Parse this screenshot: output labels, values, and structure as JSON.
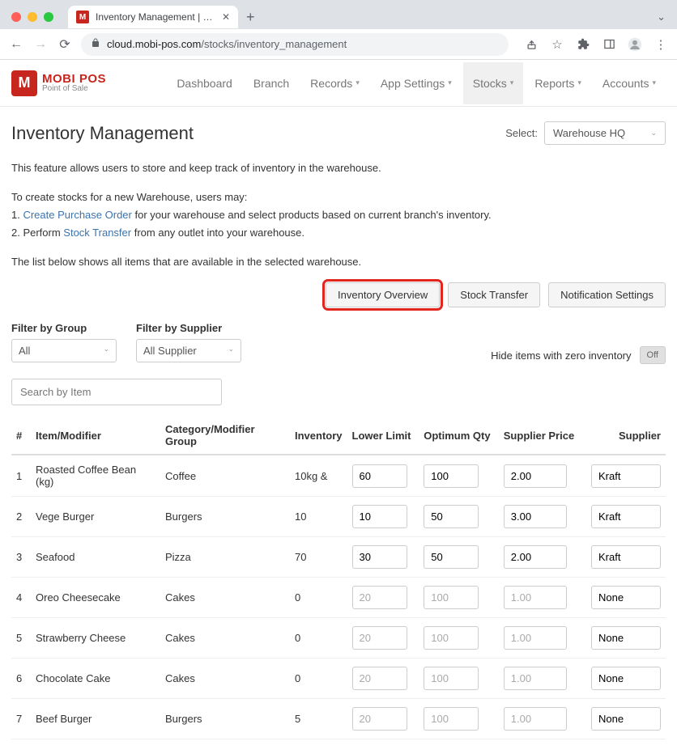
{
  "browser": {
    "tab_title": "Inventory Management | MobiP",
    "url_host": "cloud.mobi-pos.com",
    "url_path": "/stocks/inventory_management"
  },
  "logo": {
    "brand": "MOBI POS",
    "sub": "Point of Sale"
  },
  "nav": {
    "items": [
      {
        "label": "Dashboard",
        "dropdown": false
      },
      {
        "label": "Branch",
        "dropdown": false
      },
      {
        "label": "Records",
        "dropdown": true
      },
      {
        "label": "App Settings",
        "dropdown": true
      },
      {
        "label": "Stocks",
        "dropdown": true,
        "active": true
      },
      {
        "label": "Reports",
        "dropdown": true
      },
      {
        "label": "Accounts",
        "dropdown": true
      }
    ]
  },
  "page": {
    "title": "Inventory Management",
    "select_label": "Select:",
    "select_value": "Warehouse HQ",
    "intro_line": "This feature allows users to store and keep track of inventory in the warehouse.",
    "instr_head": "To create stocks for a new Warehouse, users may:",
    "instr_1_pre": "1. ",
    "instr_1_link": "Create Purchase Order",
    "instr_1_post": " for your warehouse and select products based on current branch's inventory.",
    "instr_2_pre": "2. Perform ",
    "instr_2_link": "Stock Transfer",
    "instr_2_post": " from any outlet into your warehouse.",
    "list_intro": "The list below shows all items that are available in the selected warehouse.",
    "btn_overview": "Inventory Overview",
    "btn_transfer": "Stock Transfer",
    "btn_notif": "Notification Settings",
    "filter_group_label": "Filter by Group",
    "filter_group_value": "All",
    "filter_supplier_label": "Filter by Supplier",
    "filter_supplier_value": "All Supplier",
    "hide_zero_label": "Hide items with zero inventory",
    "hide_zero_toggle": "Off",
    "search_placeholder": "Search by Item"
  },
  "table": {
    "headers": {
      "num": "#",
      "item": "Item/Modifier",
      "category": "Category/Modifier Group",
      "inventory": "Inventory",
      "lower": "Lower Limit",
      "optimum": "Optimum Qty",
      "price": "Supplier Price",
      "supplier": "Supplier"
    },
    "rows": [
      {
        "n": "1",
        "item": "Roasted Coffee Bean (kg)",
        "cat": "Coffee",
        "inv": "10kg &",
        "lower": "60",
        "opt": "100",
        "price": "2.00",
        "sup": "Kraft",
        "disabled": false
      },
      {
        "n": "2",
        "item": "Vege Burger",
        "cat": "Burgers",
        "inv": "10",
        "lower": "10",
        "opt": "50",
        "price": "3.00",
        "sup": "Kraft",
        "disabled": false
      },
      {
        "n": "3",
        "item": "Seafood",
        "cat": "Pizza",
        "inv": "70",
        "lower": "30",
        "opt": "50",
        "price": "2.00",
        "sup": "Kraft",
        "disabled": false
      },
      {
        "n": "4",
        "item": "Oreo Cheesecake",
        "cat": "Cakes",
        "inv": "0",
        "lower": "20",
        "opt": "100",
        "price": "1.00",
        "sup": "None",
        "disabled": true
      },
      {
        "n": "5",
        "item": "Strawberry Cheese",
        "cat": "Cakes",
        "inv": "0",
        "lower": "20",
        "opt": "100",
        "price": "1.00",
        "sup": "None",
        "disabled": true
      },
      {
        "n": "6",
        "item": "Chocolate Cake",
        "cat": "Cakes",
        "inv": "0",
        "lower": "20",
        "opt": "100",
        "price": "1.00",
        "sup": "None",
        "disabled": true
      },
      {
        "n": "7",
        "item": "Beef Burger",
        "cat": "Burgers",
        "inv": "5",
        "lower": "20",
        "opt": "100",
        "price": "1.00",
        "sup": "None",
        "disabled": true
      }
    ]
  }
}
